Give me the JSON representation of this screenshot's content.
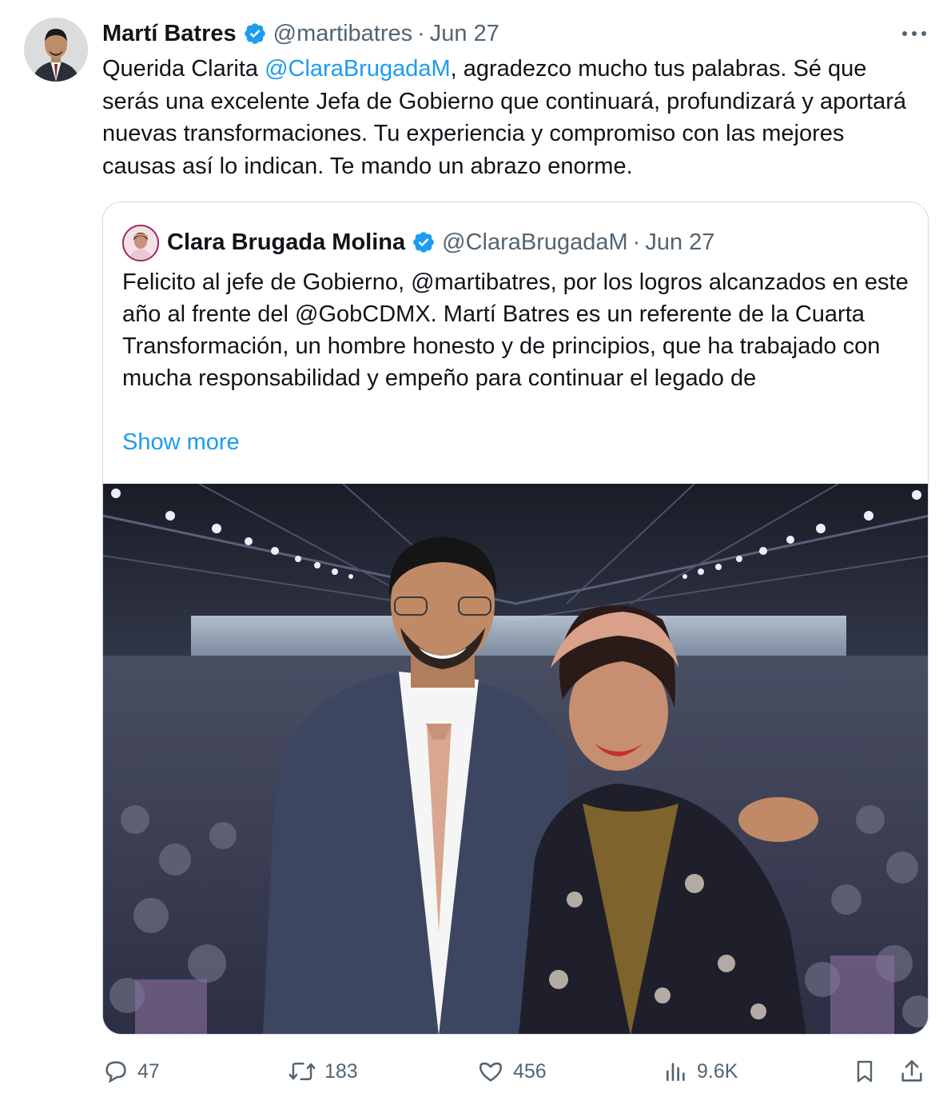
{
  "tweet": {
    "author": {
      "name": "Martí Batres",
      "handle": "@martibatres",
      "date": "Jun 27",
      "verified": true
    },
    "text": {
      "part1": "Querida Clarita ",
      "mention": "@ClaraBrugadaM",
      "part2": ", agradezco mucho tus palabras. Sé que serás una excelente Jefa de Gobierno que continuará, profundizará y aportará nuevas transformaciones. Tu experiencia y compromiso con las mejores causas así lo indican. Te mando un abrazo enorme."
    },
    "separator": "·"
  },
  "quote": {
    "author": {
      "name": "Clara Brugada Molina",
      "handle": "@ClaraBrugadaM",
      "date": "Jun 27",
      "verified": true
    },
    "text": "Felicito al jefe de Gobierno, @martibatres, por los logros alcanzados en este año al frente del @GobCDMX. Martí Batres es un referente de la Cuarta Transformación, un hombre honesto y de principios, que ha trabajado con mucha responsabilidad y empeño para continuar el legado de",
    "show_more": "Show more",
    "image": {
      "description_icon": "photo"
    }
  },
  "actions": {
    "replies": "47",
    "reposts": "183",
    "likes": "456",
    "views": "9.6K"
  },
  "icons": {
    "verified": "verified-badge-icon",
    "more": "more-horizontal-icon",
    "reply": "reply-icon",
    "repost": "repost-icon",
    "like": "heart-icon",
    "views": "views-chart-icon",
    "bookmark": "bookmark-icon",
    "share": "share-icon"
  },
  "colors": {
    "text": "#0f1419",
    "secondary": "#536471",
    "link": "#1d9bf0",
    "border": "#cfd9de",
    "verified": "#1d9bf0"
  }
}
